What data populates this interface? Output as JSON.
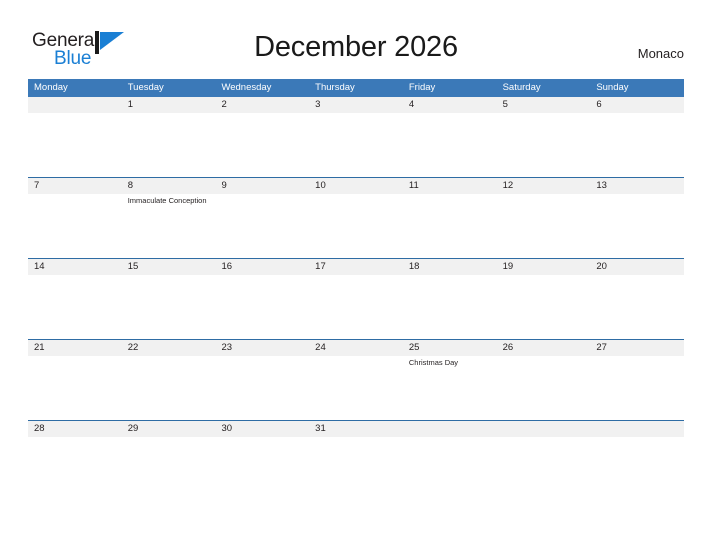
{
  "brand": {
    "name_part1": "General",
    "name_part2": "Blue",
    "flag_icon": "blue-flag-icon",
    "accent_color": "#1a7fd4"
  },
  "header": {
    "title": "December 2026",
    "location": "Monaco"
  },
  "colors": {
    "header_bar": "#3b79b8",
    "date_strip": "#f1f1f1",
    "row_divider": "#2e6ca4",
    "text": "#231f20"
  },
  "calendar": {
    "weekdays": [
      "Monday",
      "Tuesday",
      "Wednesday",
      "Thursday",
      "Friday",
      "Saturday",
      "Sunday"
    ],
    "weeks": [
      {
        "days": [
          {
            "date": "",
            "event": ""
          },
          {
            "date": "1",
            "event": ""
          },
          {
            "date": "2",
            "event": ""
          },
          {
            "date": "3",
            "event": ""
          },
          {
            "date": "4",
            "event": ""
          },
          {
            "date": "5",
            "event": ""
          },
          {
            "date": "6",
            "event": ""
          }
        ]
      },
      {
        "days": [
          {
            "date": "7",
            "event": ""
          },
          {
            "date": "8",
            "event": "Immaculate Conception"
          },
          {
            "date": "9",
            "event": ""
          },
          {
            "date": "10",
            "event": ""
          },
          {
            "date": "11",
            "event": ""
          },
          {
            "date": "12",
            "event": ""
          },
          {
            "date": "13",
            "event": ""
          }
        ]
      },
      {
        "days": [
          {
            "date": "14",
            "event": ""
          },
          {
            "date": "15",
            "event": ""
          },
          {
            "date": "16",
            "event": ""
          },
          {
            "date": "17",
            "event": ""
          },
          {
            "date": "18",
            "event": ""
          },
          {
            "date": "19",
            "event": ""
          },
          {
            "date": "20",
            "event": ""
          }
        ]
      },
      {
        "days": [
          {
            "date": "21",
            "event": ""
          },
          {
            "date": "22",
            "event": ""
          },
          {
            "date": "23",
            "event": ""
          },
          {
            "date": "24",
            "event": ""
          },
          {
            "date": "25",
            "event": "Christmas Day"
          },
          {
            "date": "26",
            "event": ""
          },
          {
            "date": "27",
            "event": ""
          }
        ]
      },
      {
        "days": [
          {
            "date": "28",
            "event": ""
          },
          {
            "date": "29",
            "event": ""
          },
          {
            "date": "30",
            "event": ""
          },
          {
            "date": "31",
            "event": ""
          },
          {
            "date": "",
            "event": ""
          },
          {
            "date": "",
            "event": ""
          },
          {
            "date": "",
            "event": ""
          }
        ]
      }
    ]
  }
}
